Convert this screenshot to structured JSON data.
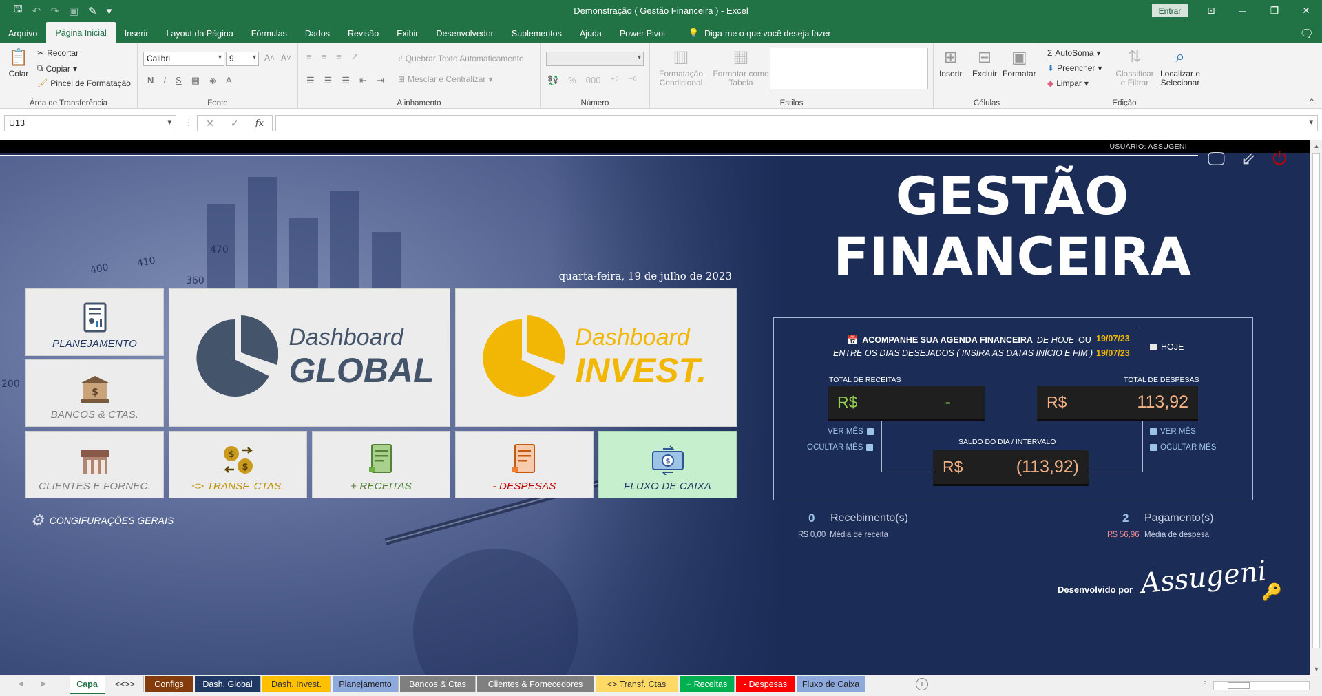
{
  "window": {
    "title": "Demonstração ( Gestão Financeira )  -  Excel",
    "signin_label": "Entrar"
  },
  "ribbon_tabs": [
    "Arquivo",
    "Página Inicial",
    "Inserir",
    "Layout da Página",
    "Fórmulas",
    "Dados",
    "Revisão",
    "Exibir",
    "Desenvolvedor",
    "Suplementos",
    "Ajuda",
    "Power Pivot"
  ],
  "tell_me": "Diga-me o que você deseja fazer",
  "ribbon": {
    "clipboard": {
      "paste": "Colar",
      "cut": "Recortar",
      "copy": "Copiar",
      "format_painter": "Pincel de Formatação",
      "label": "Área de Transferência"
    },
    "font": {
      "name": "Calibri",
      "size": "9",
      "bold": "N",
      "italic": "I",
      "underline": "S",
      "color": "A",
      "label": "Fonte"
    },
    "alignment": {
      "wrap": "Quebrar Texto Automaticamente",
      "merge": "Mesclar e Centralizar",
      "label": "Alinhamento"
    },
    "number": {
      "percent": "%",
      "thousands": "000",
      "label": "Número"
    },
    "styles": {
      "conditional": "Formatação Condicional",
      "as_table": "Formatar como Tabela",
      "label": "Estilos"
    },
    "cells": {
      "insert": "Inserir",
      "delete": "Excluir",
      "format": "Formatar",
      "label": "Células"
    },
    "editing": {
      "autosum": "AutoSoma",
      "fill": "Preencher",
      "clear": "Limpar",
      "sort": "Classificar e Filtrar",
      "find": "Localizar e Selecionar",
      "label": "Edição"
    }
  },
  "formula_bar": {
    "name_box": "U13",
    "fx": "fx",
    "value": ""
  },
  "dashboard": {
    "user_label": "USUÁRIO: ASSUGENI",
    "date_text": "quarta-feira, 19 de julho de 2023",
    "tiles": {
      "planejamento": "PLANEJAMENTO",
      "bancos": "BANCOS & CTAS.",
      "clientes": "CLIENTES E FORNEC.",
      "transf": "<> TRANSF. CTAS.",
      "receitas": "+ RECEITAS",
      "despesas": "- DESPESAS",
      "fluxo": "FLUXO DE CAIXA"
    },
    "dash_global": {
      "line1": "Dashboard",
      "line2": "GLOBAL"
    },
    "dash_invest": {
      "line1": "Dashboard",
      "line2": "INVEST."
    },
    "config_link": "CONGIFURAÇÕES GERAIS",
    "title_line1": "GESTÃO",
    "title_line2": "FINANCEIRA",
    "agenda": {
      "bold_text": "ACOMPANHE SUA AGENDA FINANCEIRA",
      "italic_text": "DE HOJE",
      "ou": "OU",
      "line2": "ENTRE OS DIAS DESEJADOS ( INSIRA AS DATAS INÍCIO E FIM )",
      "date_start": "19/07/23",
      "date_end": "19/07/23",
      "today_button": "HOJE"
    },
    "receitas": {
      "label": "TOTAL DE RECEITAS",
      "currency": "R$",
      "value": "-",
      "show_month": "VER MÊS",
      "hide_month": "OCULTAR MÊS"
    },
    "despesas": {
      "label": "TOTAL DE DESPESAS",
      "currency": "R$",
      "value": "113,92",
      "show_month": "VER MÊS",
      "hide_month": "OCULTAR MÊS"
    },
    "saldo": {
      "label": "SALDO DO DIA / INTERVALO",
      "currency": "R$",
      "value": "(113,92)"
    },
    "recebimentos": {
      "count": "0",
      "label": "Recebimento(s)",
      "avg_value": "R$ 0,00",
      "avg_label": "Média de receita"
    },
    "pagamentos": {
      "count": "2",
      "label": "Pagamento(s)",
      "avg_value": "R$ 56,96",
      "avg_label": "Média de despesa"
    },
    "developed_by": "Desenvolvido por",
    "signature": "Assugeni",
    "bg_numbers": [
      "400",
      "410",
      "470",
      "360",
      "200"
    ],
    "colors": {
      "navy": "#1b2c57",
      "yellow": "#f2b705",
      "slate": "#44546a",
      "green_tile": "#c6efce"
    }
  },
  "sheet_tabs": [
    {
      "label": "Capa",
      "bg": "#ffffff",
      "fg": "#217346"
    },
    {
      "label": "<<>>",
      "bg": "#f0f0f0",
      "fg": "#333333"
    },
    {
      "label": "Configs",
      "bg": "#843c0c",
      "fg": "#ffffff"
    },
    {
      "label": "Dash. Global",
      "bg": "#1f3864",
      "fg": "#ffffff"
    },
    {
      "label": "Dash. Invest.",
      "bg": "#ffc000",
      "fg": "#333333"
    },
    {
      "label": "Planejamento",
      "bg": "#8ea9db",
      "fg": "#222222"
    },
    {
      "label": "Bancos & Ctas",
      "bg": "#7f7f7f",
      "fg": "#ffffff"
    },
    {
      "label": "Clientes & Fornecedores",
      "bg": "#808080",
      "fg": "#ffffff"
    },
    {
      "label": "<> Transf. Ctas",
      "bg": "#ffd966",
      "fg": "#333333"
    },
    {
      "label": "+ Receitas",
      "bg": "#00b050",
      "fg": "#ffffff"
    },
    {
      "label": "- Despesas",
      "bg": "#ff0000",
      "fg": "#ffffff"
    },
    {
      "label": "Fluxo de Caixa",
      "bg": "#8ea9db",
      "fg": "#222222"
    }
  ]
}
